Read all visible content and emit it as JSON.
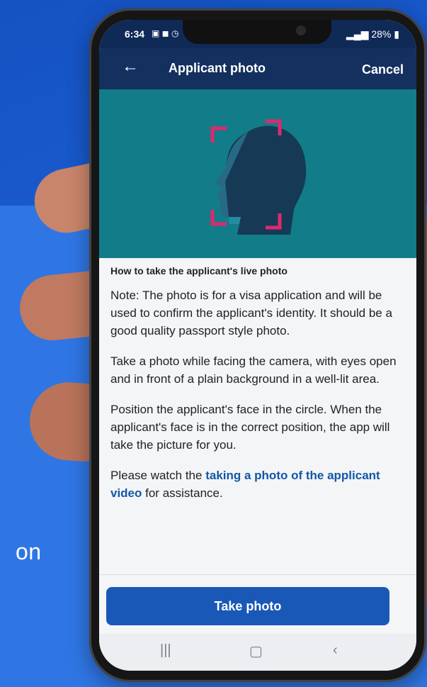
{
  "slide": {
    "text_fragment": "on"
  },
  "status_bar": {
    "time": "6:34",
    "left_icons": "▣ ◼ ◷",
    "battery": "28%"
  },
  "app_bar": {
    "title": "Applicant photo",
    "cancel_label": "Cancel",
    "back_icon": "←"
  },
  "content": {
    "heading": "How to take the applicant's live photo",
    "note": "Note: The photo is for a visa application and will be used to confirm the applicant's identity. It should be a good quality passport style photo.",
    "instruction1": "Take a photo while facing the camera, with eyes open and in front of a plain background in a well-lit area.",
    "instruction2": "Position the applicant's face in the circle. When the applicant's face is in the correct position, the app will take the picture for you.",
    "assist_prefix": "Please watch the ",
    "assist_link": "taking a photo of the applicant video",
    "assist_suffix": " for assistance."
  },
  "actions": {
    "take_photo_label": "Take photo"
  },
  "nav": {
    "recent": "|||",
    "home": "▢",
    "back": "‹"
  },
  "colors": {
    "header": "#13305f",
    "hero": "#137c89",
    "primary_button": "#1a58b8",
    "link": "#1357a8",
    "frame_accent": "#e0286d"
  }
}
